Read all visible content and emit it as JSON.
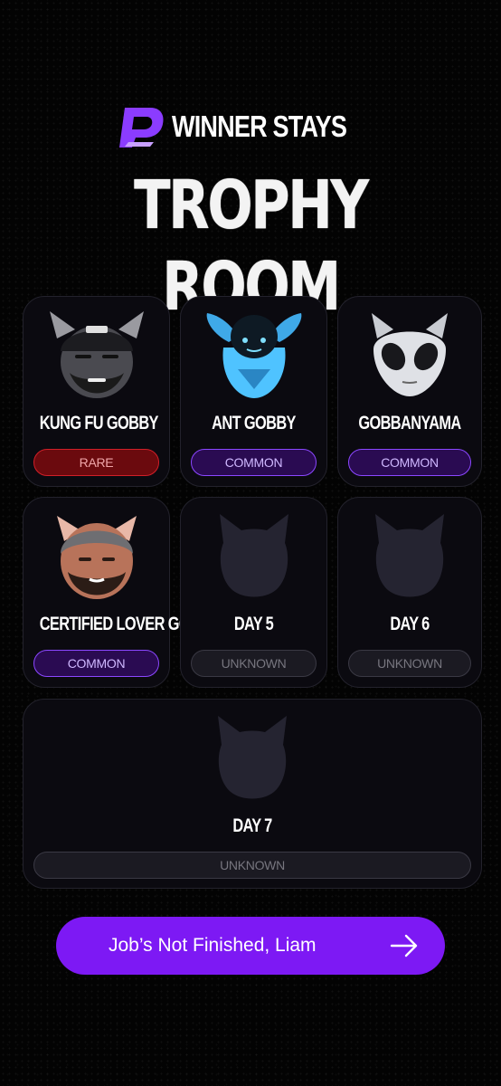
{
  "header": {
    "brand_name": "WINNER STAYS",
    "title": "TROPHY ROOM"
  },
  "trophies": [
    {
      "name": "KUNG FU GOBBY",
      "rarity": "RARE",
      "avatar": "kung-fu-gobby-avatar"
    },
    {
      "name": "ANT GOBBY",
      "rarity": "COMMON",
      "avatar": "ant-gobby-avatar"
    },
    {
      "name": "GOBBANYAMA",
      "rarity": "COMMON",
      "avatar": "gobbanyama-avatar"
    },
    {
      "name": "CERTIFIED LOVER GOB",
      "rarity": "COMMON",
      "avatar": "certified-lover-gob-avatar"
    },
    {
      "name": "DAY 5",
      "rarity": "UNKNOWN",
      "avatar": "locked-silhouette-icon"
    },
    {
      "name": "DAY 6",
      "rarity": "UNKNOWN",
      "avatar": "locked-silhouette-icon"
    },
    {
      "name": "DAY 7",
      "rarity": "UNKNOWN",
      "avatar": "locked-silhouette-icon"
    }
  ],
  "cta": {
    "label": "Job’s Not Finished, Liam",
    "icon": "arrow-right-icon"
  },
  "colors": {
    "background": "#030303",
    "accent_purple": "#7d19f4",
    "rare_red": "#d11f28",
    "common_purple": "#8b47ff",
    "card_bg": "#0b0a10"
  }
}
